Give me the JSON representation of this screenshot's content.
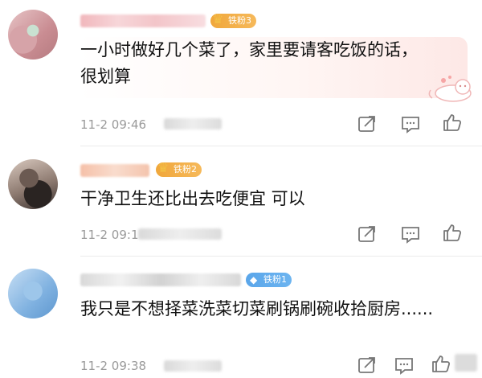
{
  "comments": [
    {
      "badge_label": "铁粉3",
      "text": "一小时做好几个菜了，家里要请客吃饭的话，很划算",
      "time": "11-2 09:46"
    },
    {
      "badge_label": "铁粉2",
      "text": "干净卫生还比出去吃便宜 可以",
      "time": "11-2 09:1"
    },
    {
      "badge_label": "铁粉1",
      "text": "我只是不想择菜洗菜切菜刷锅刷碗收拾厨房......",
      "time": "11-2 09:38"
    }
  ],
  "icons": [
    "repost-icon",
    "comment-icon",
    "like-icon",
    "fan-crown-icon",
    "fan-diamond-icon"
  ],
  "colors": {
    "badge_gold": "#f0a73b",
    "badge_blue": "#5aa6ea",
    "meta_gray": "#9a9a9a",
    "text": "#111111"
  }
}
